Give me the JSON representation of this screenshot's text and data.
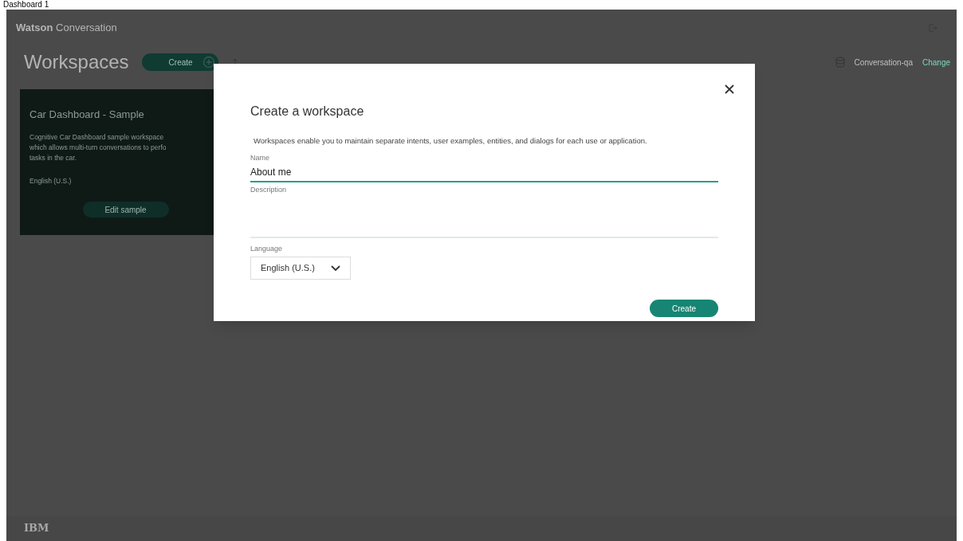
{
  "caption": "Dashboard 1",
  "header": {
    "brand_bold": "Watson",
    "brand": "Conversation"
  },
  "page": {
    "title": "Workspaces",
    "create_button": "Create",
    "instance": "Conversation-qa",
    "change_link": "Change"
  },
  "card": {
    "title": "Car Dashboard - Sample",
    "description": "Cognitive Car Dashboard sample workspace",
    "description_2": "which allows multi-turn conversations to perfo",
    "description_3": "tasks in the car.",
    "language": "English (U.S.)",
    "button": "Edit sample"
  },
  "dialog": {
    "title": "Create a workspace",
    "intro": "Workspaces enable you to maintain separate intents, user examples, entities, and dialogs for each use or application.",
    "fields": [
      {
        "kind": "text",
        "label": "Name",
        "value": "About me",
        "focused": true
      },
      {
        "kind": "textarea",
        "label": "Description",
        "focused": false
      },
      {
        "kind": "select",
        "label": "Language",
        "value": "English (U.S.)",
        "focused": false
      }
    ],
    "submit": "Create"
  },
  "footer": {
    "logo": "IBM"
  }
}
